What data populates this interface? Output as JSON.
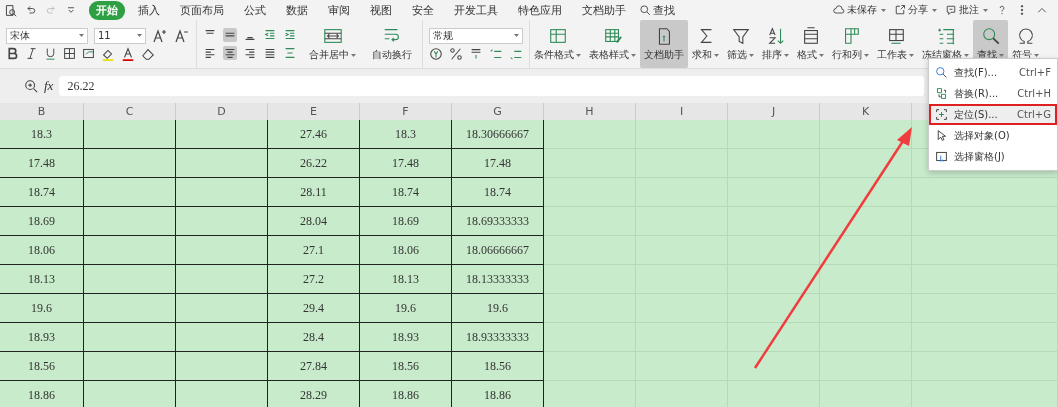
{
  "tabs": [
    {
      "label": "开始",
      "selected": true
    },
    {
      "label": "插入",
      "selected": false
    },
    {
      "label": "页面布局",
      "selected": false
    },
    {
      "label": "公式",
      "selected": false
    },
    {
      "label": "数据",
      "selected": false
    },
    {
      "label": "审阅",
      "selected": false
    },
    {
      "label": "视图",
      "selected": false
    },
    {
      "label": "安全",
      "selected": false
    },
    {
      "label": "开发工具",
      "selected": false
    },
    {
      "label": "特色应用",
      "selected": false
    },
    {
      "label": "文档助手",
      "selected": false
    }
  ],
  "search_tab": {
    "label": "查找"
  },
  "account_actions": [
    {
      "kind": "cloud",
      "label": "未保存"
    },
    {
      "kind": "share",
      "label": "分享"
    },
    {
      "kind": "comment",
      "label": "批注"
    }
  ],
  "ribbon": {
    "font_name": "宋体",
    "font_size": "11",
    "merge_label": "合并居中",
    "wrap_label": "自动换行",
    "number_format": "常规",
    "buttons": [
      {
        "kind": "conditional",
        "label": "条件格式",
        "dropdown": true,
        "selected": false
      },
      {
        "kind": "tablestyle",
        "label": "表格样式",
        "dropdown": true,
        "selected": false
      },
      {
        "kind": "assistant",
        "label": "文档助手",
        "dropdown": false,
        "selected": true
      },
      {
        "kind": "sum",
        "label": "求和",
        "dropdown": true,
        "selected": false
      },
      {
        "kind": "filter",
        "label": "筛选",
        "dropdown": true,
        "selected": false
      },
      {
        "kind": "sort",
        "label": "排序",
        "dropdown": true,
        "selected": false
      },
      {
        "kind": "format",
        "label": "格式",
        "dropdown": true,
        "selected": false
      },
      {
        "kind": "rowcol",
        "label": "行和列",
        "dropdown": true,
        "selected": false
      },
      {
        "kind": "sheet",
        "label": "工作表",
        "dropdown": true,
        "selected": false
      },
      {
        "kind": "freeze",
        "label": "冻结窗格",
        "dropdown": true,
        "selected": false
      },
      {
        "kind": "find",
        "label": "查找",
        "dropdown": true,
        "selected": true
      },
      {
        "kind": "symbol",
        "label": "符号",
        "dropdown": true,
        "selected": false
      }
    ]
  },
  "formula_bar": {
    "label": "fx",
    "value": "26.22"
  },
  "columns": [
    "B",
    "C",
    "D",
    "E",
    "F",
    "G",
    "H",
    "I",
    "J",
    "K"
  ],
  "rows": [
    {
      "B": "18.3",
      "E": "27.46",
      "F": "18.3",
      "G": "18.30666667"
    },
    {
      "B": "17.48",
      "E": "26.22",
      "F": "17.48",
      "G": "17.48"
    },
    {
      "B": "18.74",
      "E": "28.11",
      "F": "18.74",
      "G": "18.74"
    },
    {
      "B": "18.69",
      "E": "28.04",
      "F": "18.69",
      "G": "18.69333333"
    },
    {
      "B": "18.06",
      "E": "27.1",
      "F": "18.06",
      "G": "18.06666667"
    },
    {
      "B": "18.13",
      "E": "27.2",
      "F": "18.13",
      "G": "18.13333333"
    },
    {
      "B": "19.6",
      "E": "29.4",
      "F": "19.6",
      "G": "19.6"
    },
    {
      "B": "18.93",
      "E": "28.4",
      "F": "18.93",
      "G": "18.93333333"
    },
    {
      "B": "18.56",
      "E": "27.84",
      "F": "18.56",
      "G": "18.56"
    },
    {
      "B": "18.86",
      "E": "28.29",
      "F": "18.86",
      "G": "18.86"
    }
  ],
  "menu": {
    "items": [
      {
        "kind": "find",
        "label": "查找(F)...",
        "shortcut": "Ctrl+F",
        "highlighted": false
      },
      {
        "kind": "replace",
        "label": "替换(R)...",
        "shortcut": "Ctrl+H",
        "highlighted": false
      },
      {
        "kind": "goto",
        "label": "定位(S)...",
        "shortcut": "Ctrl+G",
        "highlighted": true
      },
      {
        "kind": "select",
        "label": "选择对象(O)",
        "highlighted": false
      },
      {
        "kind": "pane",
        "label": "选择窗格(J)",
        "highlighted": false
      }
    ]
  }
}
